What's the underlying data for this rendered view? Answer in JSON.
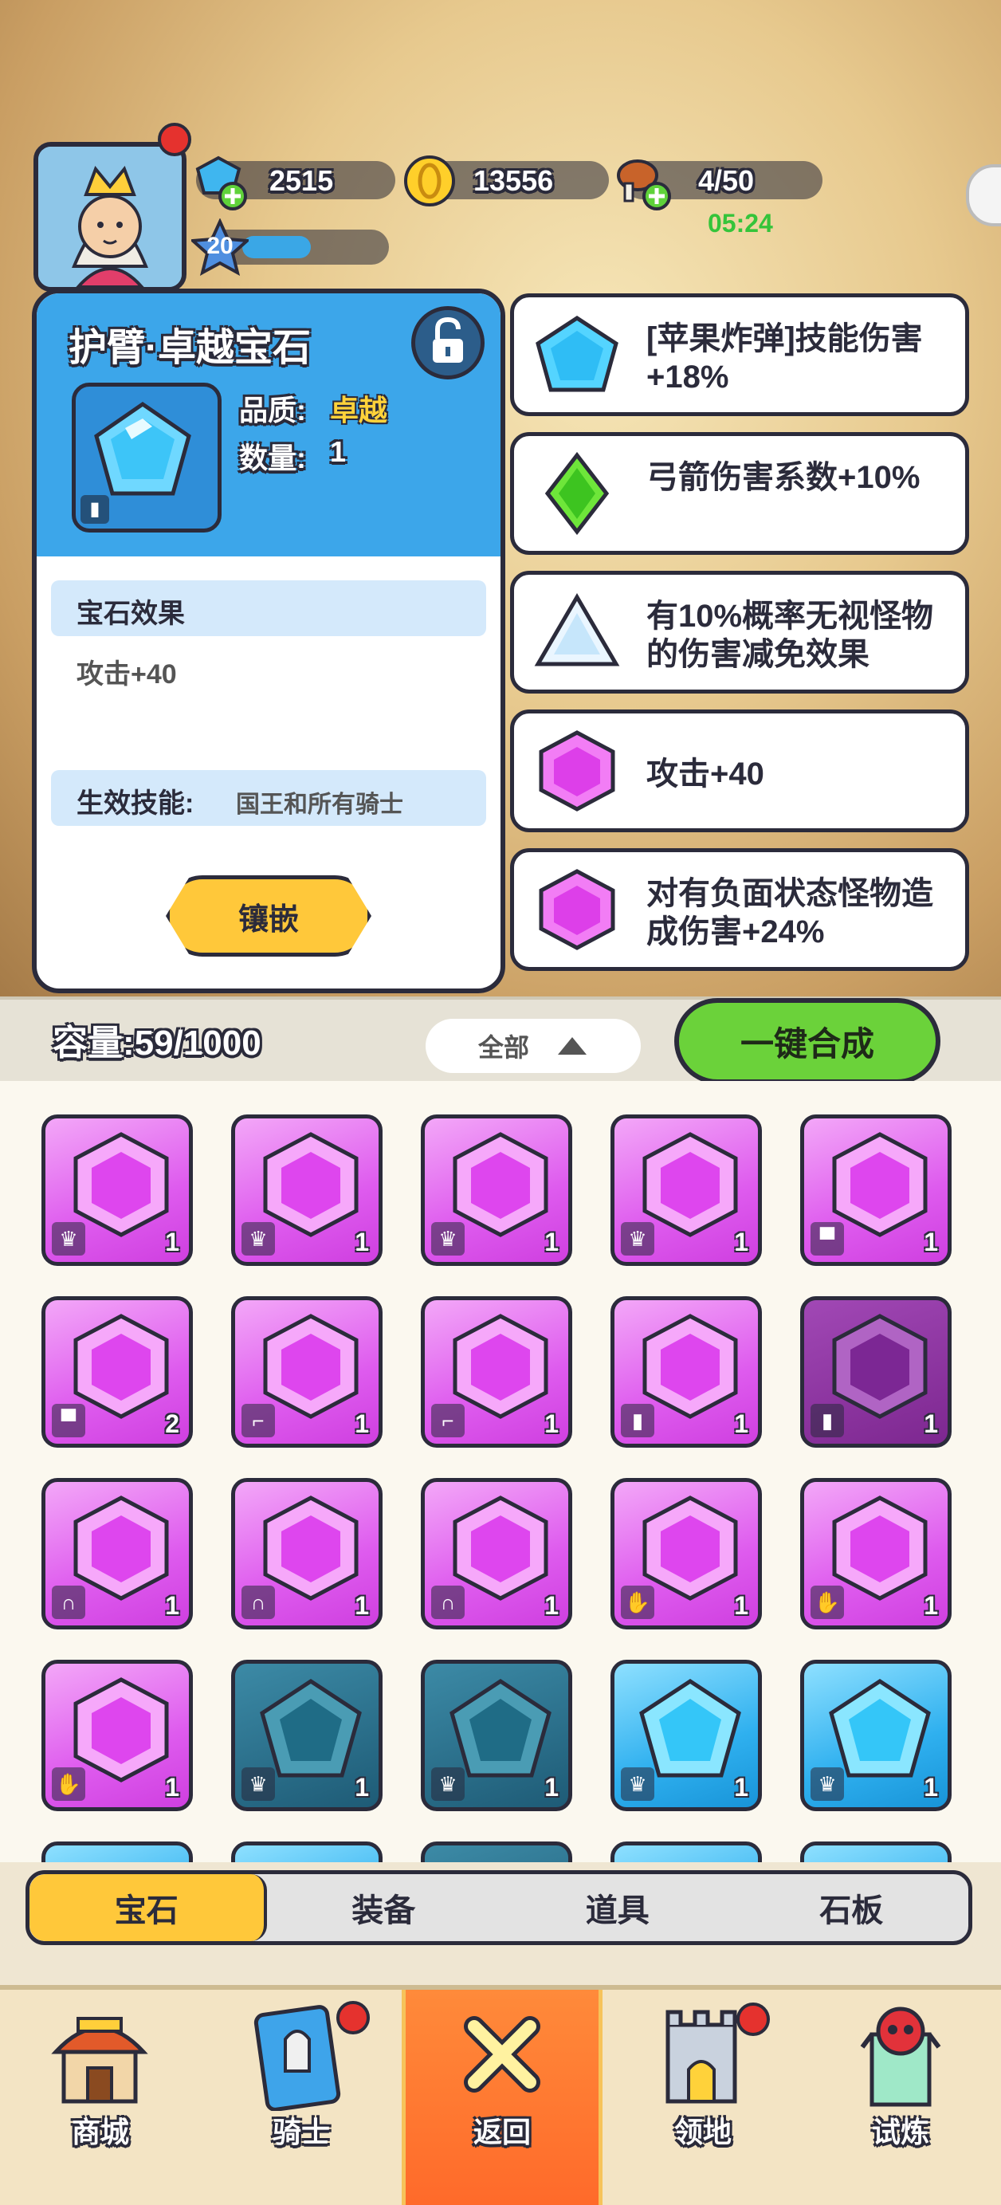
{
  "hud": {
    "gems": "2515",
    "gold": "13556",
    "food": "4/50",
    "food_timer": "05:24",
    "level": "20"
  },
  "detail": {
    "title": "护臂·卓越宝石",
    "quality_label": "品质:",
    "quality_value": "卓越",
    "count_label": "数量:",
    "count_value": "1",
    "effect_header": "宝石效果",
    "effect_value": "攻击+40",
    "skill_label": "生效技能:",
    "skill_value": "国王和所有骑士",
    "inlay_button": "镶嵌"
  },
  "effects": [
    {
      "text": "[苹果炸弹]技能伤害+18%",
      "icon": "blue-pentagon-gem-icon"
    },
    {
      "text": "弓箭伤害系数+10%",
      "icon": "green-diamond-gem-icon"
    },
    {
      "text": "有10%概率无视怪物的伤害减免效果",
      "icon": "white-triangle-gem-icon"
    },
    {
      "text": "攻击+40",
      "icon": "pink-hexagon-gem-icon"
    },
    {
      "text": "对有负面状态怪物造成伤害+24%",
      "icon": "pink-hexagon-gem-icon"
    }
  ],
  "inventory": {
    "capacity": "容量:59/1000",
    "filter": "全部",
    "merge_button": "一键合成",
    "items": [
      {
        "color": "pink",
        "type": "crown",
        "qty": "1"
      },
      {
        "color": "pink",
        "type": "crown",
        "qty": "1"
      },
      {
        "color": "pink",
        "type": "crown",
        "qty": "1"
      },
      {
        "color": "pink",
        "type": "crown",
        "qty": "1"
      },
      {
        "color": "pink",
        "type": "shirt",
        "qty": "1"
      },
      {
        "color": "pink",
        "type": "shirt",
        "qty": "2"
      },
      {
        "color": "pink",
        "type": "boot",
        "qty": "1"
      },
      {
        "color": "pink",
        "type": "boot",
        "qty": "1"
      },
      {
        "color": "pink",
        "type": "armguard",
        "qty": "1"
      },
      {
        "color": "pink-dark",
        "type": "armguard",
        "qty": "1"
      },
      {
        "color": "pink",
        "type": "pants",
        "qty": "1"
      },
      {
        "color": "pink",
        "type": "pants",
        "qty": "1"
      },
      {
        "color": "pink",
        "type": "pants",
        "qty": "1"
      },
      {
        "color": "pink",
        "type": "glove",
        "qty": "1"
      },
      {
        "color": "pink",
        "type": "glove",
        "qty": "1"
      },
      {
        "color": "pink",
        "type": "glove",
        "qty": "1"
      },
      {
        "color": "teal-dark",
        "type": "crown",
        "qty": "1"
      },
      {
        "color": "teal-dark",
        "type": "crown",
        "qty": "1"
      },
      {
        "color": "blue",
        "type": "crown",
        "qty": "1"
      },
      {
        "color": "blue",
        "type": "crown",
        "qty": "1"
      }
    ]
  },
  "tabs": [
    "宝石",
    "装备",
    "道具",
    "石板"
  ],
  "nav": [
    {
      "label": "商城",
      "icon": "shop-icon"
    },
    {
      "label": "骑士",
      "icon": "knight-card-icon"
    },
    {
      "label": "返回",
      "icon": "close-x-icon"
    },
    {
      "label": "领地",
      "icon": "castle-icon"
    },
    {
      "label": "试炼",
      "icon": "skull-tower-icon"
    }
  ]
}
